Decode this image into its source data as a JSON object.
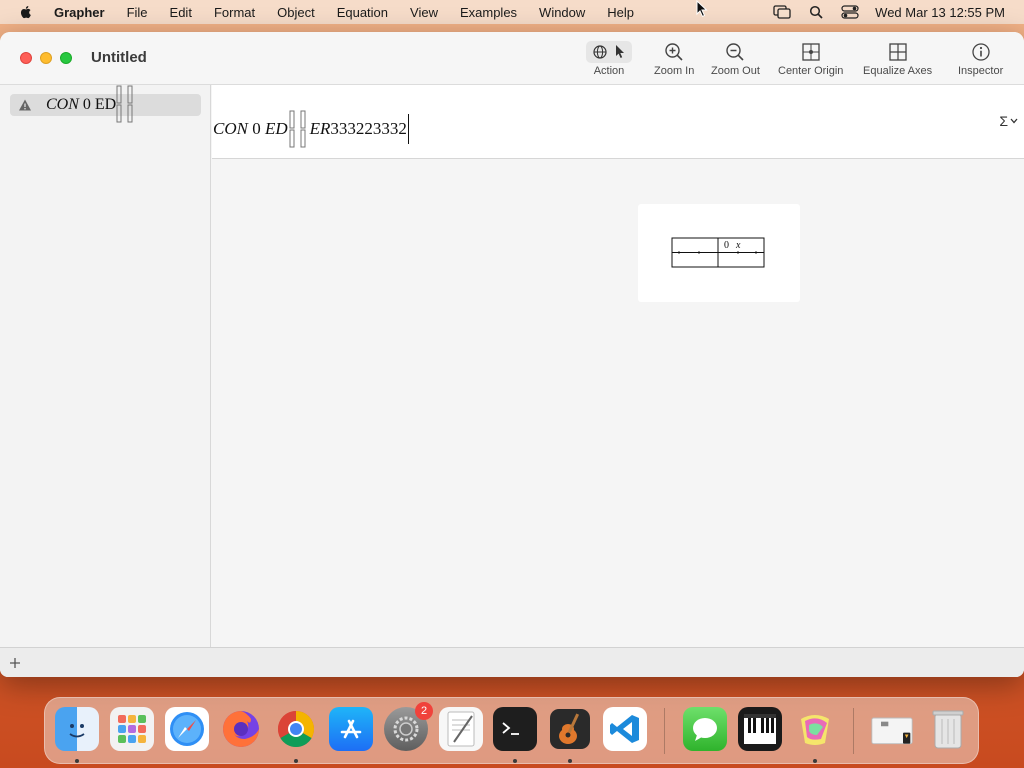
{
  "menubar": {
    "app_name": "Grapher",
    "items": [
      "File",
      "Edit",
      "Format",
      "Object",
      "Equation",
      "View",
      "Examples",
      "Window",
      "Help"
    ],
    "clock": "Wed Mar 13  12:55 PM"
  },
  "window": {
    "title": "Untitled"
  },
  "toolbar": {
    "action_label": "Action",
    "zoom_in_label": "Zoom In",
    "zoom_out_label": "Zoom Out",
    "center_origin_label": "Center Origin",
    "equalize_axes_label": "Equalize Axes",
    "inspector_label": "Inspector"
  },
  "sidebar": {
    "items": [
      {
        "status": "warning",
        "equation_italic": "CON",
        "equation_rest": " 0 ED"
      }
    ]
  },
  "equation_editor": {
    "part1_italic": "CON",
    "part2": " 0 ",
    "part3_italic": "ED",
    "part4_italic": "ER",
    "part5": "333223332",
    "menu_symbol": "Σ"
  },
  "graph_preview": {
    "origin_label": "0",
    "axis_label": "x"
  },
  "dock": {
    "apps": [
      "Finder",
      "Launchpad",
      "Safari",
      "Firefox",
      "Chrome",
      "App Store",
      "System Settings",
      "TextEdit",
      "Terminal",
      "GarageBand",
      "Visual Studio Code",
      "Messages",
      "Piano",
      "Grapher",
      "Preview",
      "Trash"
    ],
    "settings_badge": "2"
  },
  "colors": {
    "close": "#fe5f57",
    "minimize": "#febc2e",
    "maximize": "#28c840",
    "badge": "#f0423b"
  }
}
